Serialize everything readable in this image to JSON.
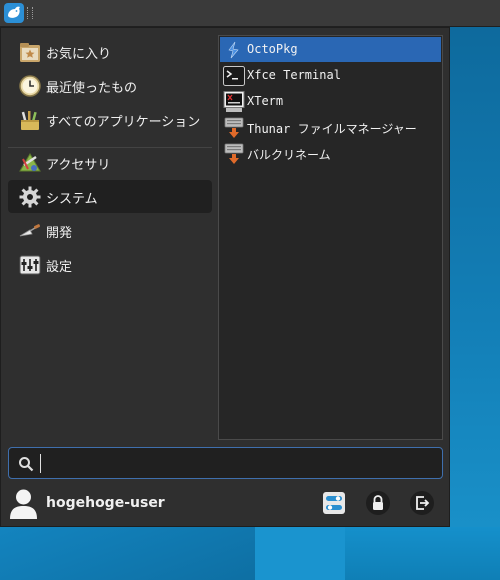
{
  "panel": {
    "menu_button_icon": "whisker-menu-icon"
  },
  "categories": [
    {
      "label": "お気に入り",
      "icon": "favorites-icon",
      "active": false
    },
    {
      "label": "最近使ったもの",
      "icon": "recent-clock-icon",
      "active": false
    },
    {
      "label": "すべてのアプリケーション",
      "icon": "all-applications-icon",
      "active": false
    },
    {
      "label": "アクセサリ",
      "icon": "accessories-icon",
      "active": false
    },
    {
      "label": "システム",
      "icon": "system-gear-icon",
      "active": true
    },
    {
      "label": "開発",
      "icon": "development-trowel-icon",
      "active": false
    },
    {
      "label": "設定",
      "icon": "settings-icon",
      "active": false
    }
  ],
  "apps": [
    {
      "label": "OctoPkg",
      "icon": "octopkg-icon",
      "selected": true
    },
    {
      "label": "Xfce Terminal",
      "icon": "terminal-icon",
      "selected": false
    },
    {
      "label": "XTerm",
      "icon": "xterm-icon",
      "selected": false
    },
    {
      "label": "Thunar ファイルマネージャー",
      "icon": "file-manager-icon",
      "selected": false
    },
    {
      "label": "バルクリネーム",
      "icon": "bulk-rename-icon",
      "selected": false
    }
  ],
  "search": {
    "value": "",
    "placeholder": "",
    "icon": "search-icon"
  },
  "user": {
    "name": "hogehoge-user",
    "avatar_icon": "user-avatar-icon"
  },
  "actions": [
    {
      "icon": "settings-manager-icon"
    },
    {
      "icon": "lock-screen-icon"
    },
    {
      "icon": "log-out-icon"
    }
  ],
  "colors": {
    "selection": "#2a67b4",
    "active_category": "#202020",
    "menu_background": "#2f2f2f"
  }
}
